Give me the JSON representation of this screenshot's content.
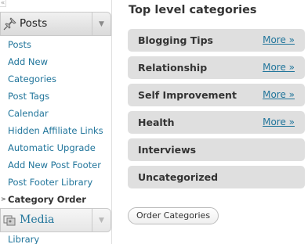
{
  "sidebar": {
    "posts_menu": {
      "label": "Posts",
      "icon": "pushpin-icon",
      "items": [
        {
          "label": "Posts"
        },
        {
          "label": "Add New"
        },
        {
          "label": "Categories"
        },
        {
          "label": "Post Tags"
        },
        {
          "label": "Calendar"
        },
        {
          "label": "Hidden Affiliate Links"
        },
        {
          "label": "Automatic Upgrade"
        },
        {
          "label": "Add New Post Footer"
        },
        {
          "label": "Post Footer Library"
        },
        {
          "label": "Category Order",
          "current": true
        }
      ]
    },
    "media_menu": {
      "label": "Media",
      "icon": "media-icon",
      "items": [
        {
          "label": "Library"
        }
      ]
    }
  },
  "main": {
    "title": "Top level categories",
    "categories": [
      {
        "name": "Blogging Tips",
        "more": "More »"
      },
      {
        "name": "Relationship",
        "more": "More »"
      },
      {
        "name": "Self Improvement",
        "more": "More »"
      },
      {
        "name": "Health",
        "more": "More »"
      },
      {
        "name": "Interviews",
        "more": ""
      },
      {
        "name": "Uncategorized",
        "more": ""
      }
    ],
    "order_button": "Order Categories"
  },
  "colors": {
    "link": "#21759b",
    "row_bg": "#dfdfdf",
    "text": "#333333"
  }
}
